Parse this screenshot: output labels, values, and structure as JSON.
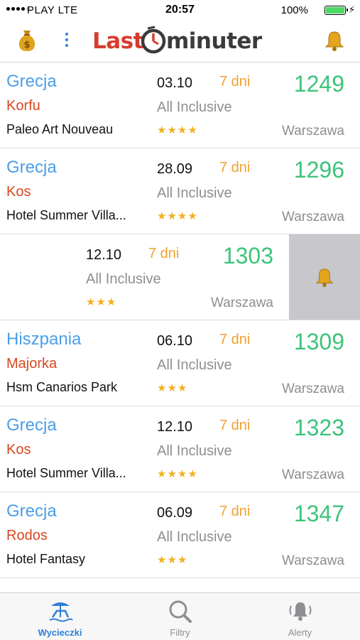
{
  "status_bar": {
    "carrier": "PLAY  LTE",
    "time": "20:57",
    "battery": "100%",
    "battery_level": 1.0
  },
  "header": {
    "logo_part1": "Last",
    "logo_part2": "minuter",
    "icons": [
      "money-bag-icon",
      "more-vertical-icon",
      "bell-icon"
    ],
    "brand_color": "#d63d2e"
  },
  "offers": [
    {
      "country": "Grecja",
      "region": "Korfu",
      "hotel": "Paleo Art Nouveau",
      "date": "03.10",
      "days": "7 dni",
      "board": "All Inclusive",
      "stars": 4,
      "price": "1249",
      "city": "Warszawa"
    },
    {
      "country": "Grecja",
      "region": "Kos",
      "hotel": "Hotel Summer Villa...",
      "date": "28.09",
      "days": "7 dni",
      "board": "All Inclusive",
      "stars": 4,
      "price": "1296",
      "city": "Warszawa"
    },
    {
      "date": "12.10",
      "days": "7 dni",
      "board": "All Inclusive",
      "stars": 3,
      "price": "1303",
      "city": "Warszawa",
      "swiped_action": "bell-icon"
    },
    {
      "country": "Hiszpania",
      "region": "Majorka",
      "hotel": "Hsm Canarios Park",
      "date": "06.10",
      "days": "7 dni",
      "board": "All Inclusive",
      "stars": 3,
      "price": "1309",
      "city": "Warszawa"
    },
    {
      "country": "Grecja",
      "region": "Kos",
      "hotel": "Hotel Summer Villa...",
      "date": "12.10",
      "days": "7 dni",
      "board": "All Inclusive",
      "stars": 4,
      "price": "1323",
      "city": "Warszawa"
    },
    {
      "country": "Grecja",
      "region": "Rodos",
      "hotel": "Hotel Fantasy",
      "date": "06.09",
      "days": "7 dni",
      "board": "All Inclusive",
      "stars": 3,
      "price": "1347",
      "city": "Warszawa"
    }
  ],
  "tabbar": {
    "tabs": [
      {
        "label": "Wycieczki",
        "icon": "beach-chair-icon",
        "active": true
      },
      {
        "label": "Filtry",
        "icon": "search-icon",
        "active": false
      },
      {
        "label": "Alerty",
        "icon": "bell-ringing-icon",
        "active": false
      }
    ]
  },
  "colors": {
    "country": "#4a9ee8",
    "region": "#d9471f",
    "price": "#3cc47a",
    "days": "#f0a030",
    "stars": "#f2b01e",
    "tab_active": "#2f7fd6"
  }
}
